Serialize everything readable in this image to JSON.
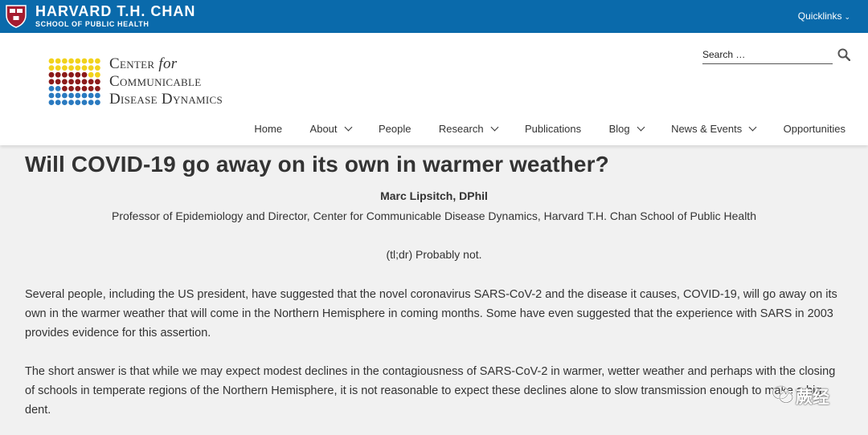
{
  "topbar": {
    "brand_title": "HARVARD T.H. CHAN",
    "brand_subtitle": "SCHOOL OF PUBLIC HEALTH",
    "quicklinks_label": "Quicklinks",
    "icon": "harvard-shield"
  },
  "header": {
    "logo": {
      "line1_main": "Center ",
      "line1_italic": "for",
      "line2": "Communicable",
      "line3": "Disease Dynamics",
      "dot_colors": [
        "#f2d21b",
        "#8b1a1a",
        "#2a7ac0"
      ]
    },
    "search": {
      "placeholder": "Search …",
      "icon": "search-icon"
    },
    "nav": [
      {
        "label": "Home",
        "has_dropdown": false
      },
      {
        "label": "About",
        "has_dropdown": true
      },
      {
        "label": "People",
        "has_dropdown": false
      },
      {
        "label": "Research",
        "has_dropdown": true
      },
      {
        "label": "Publications",
        "has_dropdown": false
      },
      {
        "label": "Blog",
        "has_dropdown": true
      },
      {
        "label": "News & Events",
        "has_dropdown": true
      },
      {
        "label": "Opportunities",
        "has_dropdown": false
      }
    ]
  },
  "article": {
    "title": "Will COVID-19 go away on its own in warmer weather?",
    "author": "Marc Lipsitch, DPhil",
    "affiliation": "Professor of Epidemiology and Director, Center for Communicable Disease Dynamics, Harvard T.H. Chan School of Public Health",
    "tldr": "(tl;dr) Probably not.",
    "paragraph1": "Several people, including the US president, have suggested that the novel coronavirus SARS-CoV-2 and the disease it causes, COVID-19, will go away on its own in the warmer weather that will come in the Northern Hemisphere in coming months. Some have even suggested that the experience with SARS in 2003 provides evidence for this assertion.",
    "paragraph2": "The short answer is that while we may expect modest declines in the contagiousness of SARS-CoV-2 in warmer, wetter weather and perhaps with the closing of schools in temperate regions of the Northern Hemisphere, it is not reasonable to expect these declines alone to slow transmission enough to make a big dent."
  },
  "watermark": {
    "text": "蕨经",
    "icon": "wechat-icon"
  },
  "colors": {
    "topbar": "#0a6aab",
    "background": "#f1f1f1",
    "text": "#333333"
  }
}
